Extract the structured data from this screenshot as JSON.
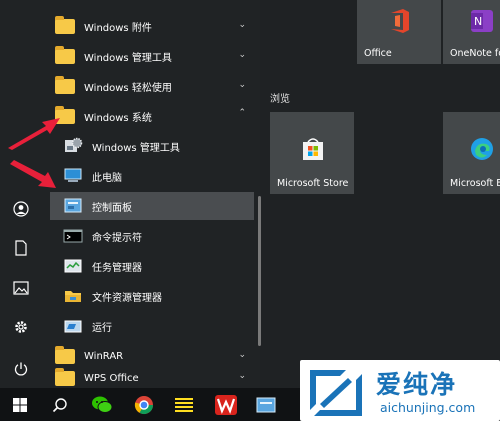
{
  "app_list": [
    {
      "label": "Windows 附件",
      "kind": "folder",
      "chevron": "⌄"
    },
    {
      "label": "Windows 管理工具",
      "kind": "folder",
      "chevron": "⌄"
    },
    {
      "label": "Windows 轻松使用",
      "kind": "folder",
      "chevron": "⌄"
    },
    {
      "label": "Windows 系统",
      "kind": "folder",
      "chevron": "⌃"
    },
    {
      "label": "Windows 管理工具",
      "kind": "app",
      "icon": "admin-tools-icon"
    },
    {
      "label": "此电脑",
      "kind": "app",
      "icon": "this-pc-icon"
    },
    {
      "label": "控制面板",
      "kind": "app",
      "icon": "control-panel-icon",
      "selected": true
    },
    {
      "label": "命令提示符",
      "kind": "app",
      "icon": "cmd-icon"
    },
    {
      "label": "任务管理器",
      "kind": "app",
      "icon": "task-manager-icon"
    },
    {
      "label": "文件资源管理器",
      "kind": "app",
      "icon": "file-explorer-icon"
    },
    {
      "label": "运行",
      "kind": "app",
      "icon": "run-icon"
    },
    {
      "label": "WinRAR",
      "kind": "folder",
      "chevron": "⌄"
    },
    {
      "label": "WPS Office",
      "kind": "folder",
      "chevron": "⌄"
    }
  ],
  "tiles": {
    "group_label": "浏览",
    "office": "Office",
    "onenote": "OneNote fo",
    "store": "Microsoft Store",
    "edge": "Microsoft E"
  },
  "watermark": {
    "chinese": "爱纯净",
    "url": "aichunjing.com"
  },
  "colors": {
    "folder": "#f7c948",
    "selected_bg": "#4a4d50",
    "arrow": "#e8203a",
    "watermark_blue": "#1a73b8"
  }
}
